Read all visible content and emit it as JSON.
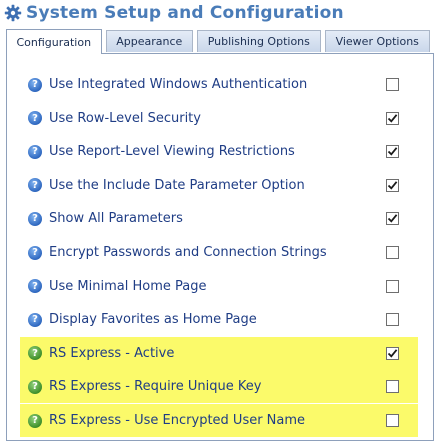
{
  "header": {
    "title": "System Setup and Configuration",
    "icon": "gear-icon"
  },
  "tabs": [
    {
      "label": "Configuration",
      "active": true
    },
    {
      "label": "Appearance",
      "active": false
    },
    {
      "label": "Publishing Options",
      "active": false
    },
    {
      "label": "Viewer Options",
      "active": false
    }
  ],
  "settings": [
    {
      "label": "Use Integrated Windows Authentication",
      "checked": false,
      "icon": "help-icon",
      "icon_color": "#2f68c0"
    },
    {
      "label": "Use Row-Level Security",
      "checked": true,
      "icon": "help-icon",
      "icon_color": "#2f68c0"
    },
    {
      "label": "Use Report-Level Viewing Restrictions",
      "checked": true,
      "icon": "help-icon",
      "icon_color": "#2f68c0"
    },
    {
      "label": "Use the Include Date Parameter Option",
      "checked": true,
      "icon": "help-icon",
      "icon_color": "#2f68c0"
    },
    {
      "label": "Show All Parameters",
      "checked": true,
      "icon": "help-icon",
      "icon_color": "#2f68c0"
    },
    {
      "label": "Encrypt Passwords and Connection Strings",
      "checked": false,
      "icon": "help-icon",
      "icon_color": "#2f68c0"
    },
    {
      "label": "Use Minimal Home Page",
      "checked": false,
      "icon": "help-icon",
      "icon_color": "#2f68c0"
    },
    {
      "label": "Display Favorites as Home Page",
      "checked": false,
      "icon": "help-icon",
      "icon_color": "#2f68c0"
    },
    {
      "label": "RS Express - Active",
      "checked": true,
      "icon": "help-icon",
      "icon_color": "#3f8f2a",
      "highlight": true
    },
    {
      "label": "RS Express - Require Unique Key",
      "checked": false,
      "icon": "help-icon",
      "icon_color": "#3f8f2a",
      "highlight": true
    },
    {
      "label": "RS Express - Use Encrypted User Name",
      "checked": false,
      "icon": "help-icon",
      "icon_color": "#3f8f2a",
      "highlight": true
    }
  ],
  "colors": {
    "title": "#4a7cb8",
    "label": "#1f3d85",
    "highlight": "#fbfa6a"
  }
}
